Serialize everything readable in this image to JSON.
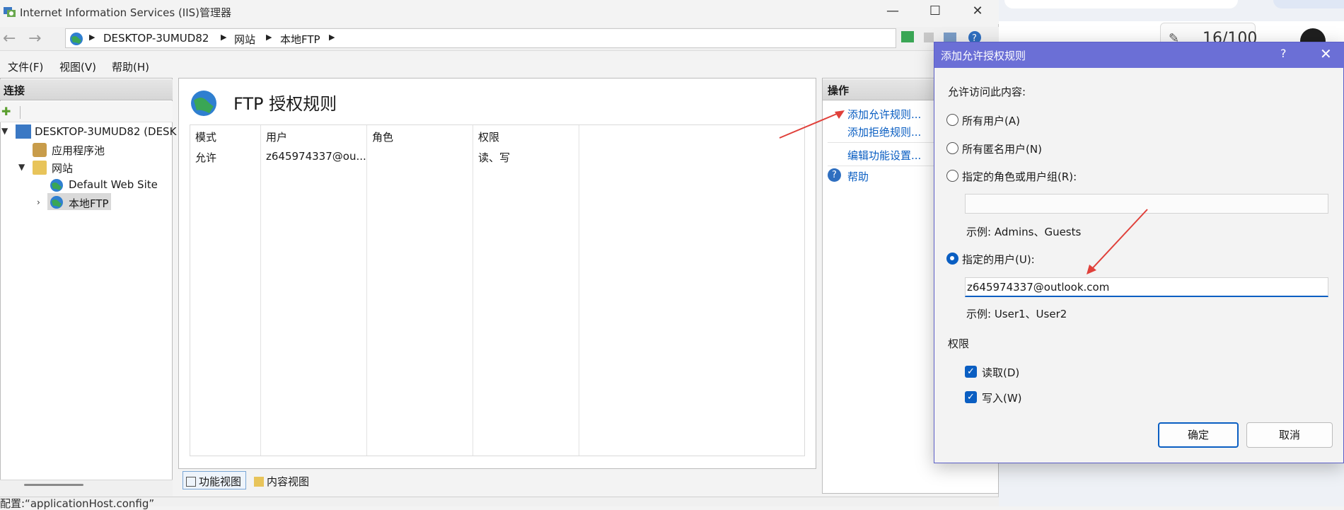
{
  "window": {
    "title": "Internet Information Services (IIS)管理器"
  },
  "breadcrumb": [
    "DESKTOP-3UMUD82",
    "网站",
    "本地FTP"
  ],
  "menu": {
    "file": "文件(F)",
    "view": "视图(V)",
    "help": "帮助(H)"
  },
  "connections": {
    "title": "连接",
    "tree": {
      "server": "DESKTOP-3UMUD82 (DESK",
      "app_pools": "应用程序池",
      "sites": "网站",
      "default_site": "Default Web Site",
      "ftp_site": "本地FTP"
    }
  },
  "main": {
    "title": "FTP 授权规则",
    "columns": [
      "模式",
      "用户",
      "角色",
      "权限"
    ],
    "rows": [
      {
        "mode": "允许",
        "user": "z645974337@ou...",
        "role": "",
        "permission": "读、写"
      }
    ],
    "tabs": {
      "features": "功能视图",
      "content": "内容视图"
    }
  },
  "actions": {
    "title": "操作",
    "add_allow": "添加允许规则...",
    "add_deny": "添加拒绝规则...",
    "edit_settings": "编辑功能设置...",
    "help": "帮助"
  },
  "status": {
    "text": "配置:“applicationHost.config”"
  },
  "dialog": {
    "title": "添加允许授权规则",
    "help_glyph": "?",
    "intro": "允许访问此内容:",
    "option_all_users": "所有用户(A)",
    "option_anonymous": "所有匿名用户(N)",
    "option_roles": "指定的角色或用户组(R):",
    "roles_value": "",
    "roles_example": "示例: Admins、Guests",
    "option_users": "指定的用户(U):",
    "users_value": "z645974337@outlook.com",
    "users_example": "示例: User1、User2",
    "permissions_label": "权限",
    "perm_read": "读取(D)",
    "perm_read_checked": true,
    "perm_write": "写入(W)",
    "perm_write_checked": true,
    "selected_option": "users",
    "ok": "确定",
    "cancel": "取消"
  },
  "background_browser": {
    "counter": "16/100"
  },
  "colors": {
    "dialog_title": "#6b6fd6",
    "link": "#0a5ec2",
    "annotation_arrow": "#e0403a"
  },
  "icons": [
    "globe-icon",
    "back-arrow-icon",
    "forward-arrow-icon",
    "close-icon",
    "help-icon",
    "checkmark-icon",
    "radio-icon",
    "arrow-annotation-icon"
  ]
}
